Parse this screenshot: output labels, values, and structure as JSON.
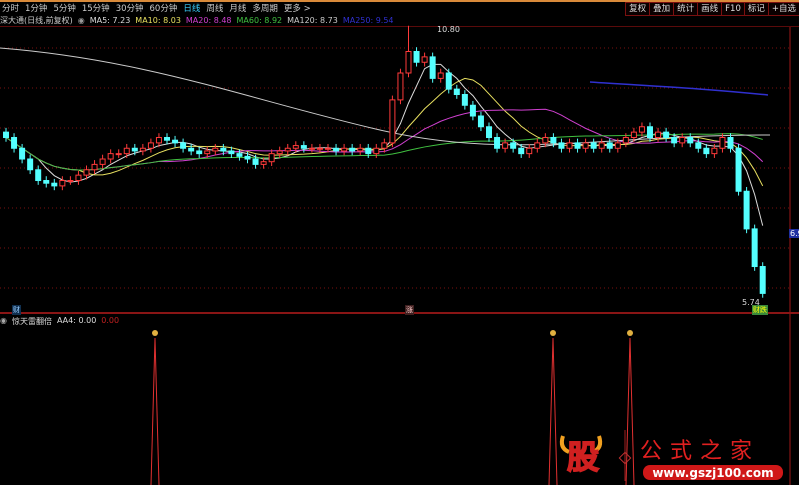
{
  "toolbar": {
    "tabs": [
      "分时",
      "1分钟",
      "5分钟",
      "15分钟",
      "30分钟",
      "60分钟",
      "日线",
      "周线",
      "月线",
      "多周期",
      "更多 >"
    ],
    "active": "日线",
    "buttons": [
      "复权",
      "叠加",
      "统计",
      "画线",
      "F10",
      "标记",
      "+自选"
    ]
  },
  "legend": {
    "name": "深大通(日线,前复权)",
    "items": [
      {
        "label": "MA5: 7.23",
        "color": "#dddddd"
      },
      {
        "label": "MA10: 8.03",
        "color": "#e8e060"
      },
      {
        "label": "MA20: 8.48",
        "color": "#d040d0"
      },
      {
        "label": "MA60: 8.92",
        "color": "#40c040"
      },
      {
        "label": "MA120: 8.73",
        "color": "#cccccc"
      },
      {
        "label": "MA250: 9.54",
        "color": "#3030d0"
      }
    ]
  },
  "annotations": {
    "high": "10.80",
    "low": "5.74",
    "axis_price": "6.9",
    "marker_cai": "财",
    "marker_zhang": "涨",
    "marker_cai_die": "财跌"
  },
  "indicator": {
    "name": "惊天雷翻倍",
    "aa4": "AA4: 0.00",
    "value2": "0.00",
    "signal_index": [
      19,
      69,
      79
    ]
  },
  "colors": {
    "up": "#ff3a3a",
    "down": "#54ffff",
    "grid": "#7a1010"
  },
  "chart_data": {
    "type": "candlestick",
    "closes": [
      8.8,
      8.6,
      8.4,
      8.2,
      8.0,
      7.95,
      7.9,
      8.0,
      8.0,
      8.1,
      8.2,
      8.3,
      8.4,
      8.5,
      8.5,
      8.6,
      8.55,
      8.6,
      8.7,
      8.8,
      8.75,
      8.7,
      8.6,
      8.55,
      8.5,
      8.55,
      8.6,
      8.55,
      8.5,
      8.45,
      8.4,
      8.3,
      8.35,
      8.5,
      8.55,
      8.6,
      8.65,
      8.6,
      8.6,
      8.6,
      8.6,
      8.55,
      8.6,
      8.55,
      8.6,
      8.5,
      8.6,
      8.7,
      9.5,
      10.0,
      10.4,
      10.2,
      10.3,
      9.9,
      10.0,
      9.7,
      9.6,
      9.4,
      9.2,
      9.0,
      8.8,
      8.6,
      8.7,
      8.6,
      8.5,
      8.6,
      8.7,
      8.8,
      8.7,
      8.6,
      8.7,
      8.6,
      8.7,
      8.6,
      8.7,
      8.6,
      8.7,
      8.8,
      8.9,
      9.0,
      8.8,
      8.9,
      8.8,
      8.7,
      8.8,
      8.7,
      8.6,
      8.5,
      8.6,
      8.8,
      8.6,
      7.8,
      7.1,
      6.4,
      5.9
    ],
    "price_high": 10.8,
    "price_low": 5.74
  }
}
